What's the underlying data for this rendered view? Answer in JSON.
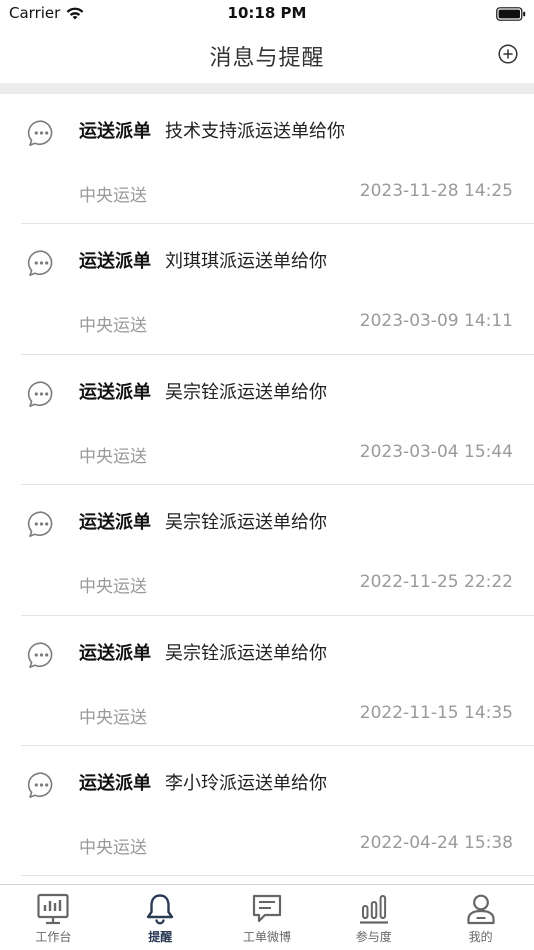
{
  "status_bar": {
    "carrier": "Carrier",
    "time": "10:18 PM",
    "icons": [
      "wifi-icon",
      "battery-icon"
    ]
  },
  "nav": {
    "title": "消息与提醒",
    "add_icon": "plus-circle-icon"
  },
  "messages": [
    {
      "type": "运送派单",
      "text": "技术支持派运送单给你",
      "source": "中央运送",
      "time": "2023-11-28 14:25"
    },
    {
      "type": "运送派单",
      "text": "刘琪琪派运送单给你",
      "source": "中央运送",
      "time": "2023-03-09 14:11"
    },
    {
      "type": "运送派单",
      "text": "吴宗铨派运送单给你",
      "source": "中央运送",
      "time": "2023-03-04 15:44"
    },
    {
      "type": "运送派单",
      "text": "吴宗铨派运送单给你",
      "source": "中央运送",
      "time": "2022-11-25 22:22"
    },
    {
      "type": "运送派单",
      "text": "吴宗铨派运送单给你",
      "source": "中央运送",
      "time": "2022-11-15 14:35"
    },
    {
      "type": "运送派单",
      "text": "李小玲派运送单给你",
      "source": "中央运送",
      "time": "2022-04-24 15:38"
    }
  ],
  "tabs": [
    {
      "label": "工作台",
      "icon": "dashboard-icon",
      "active": false
    },
    {
      "label": "提醒",
      "icon": "bell-icon",
      "active": true
    },
    {
      "label": "工单微博",
      "icon": "chat-bubble-icon",
      "active": false
    },
    {
      "label": "参与度",
      "icon": "bar-chart-icon",
      "active": false
    },
    {
      "label": "我的",
      "icon": "user-icon",
      "active": false
    }
  ],
  "colors": {
    "active_tab": "#2a3a55",
    "inactive_tab": "#666666",
    "secondary_text": "#9a9a9a",
    "divider": "#ececec"
  }
}
